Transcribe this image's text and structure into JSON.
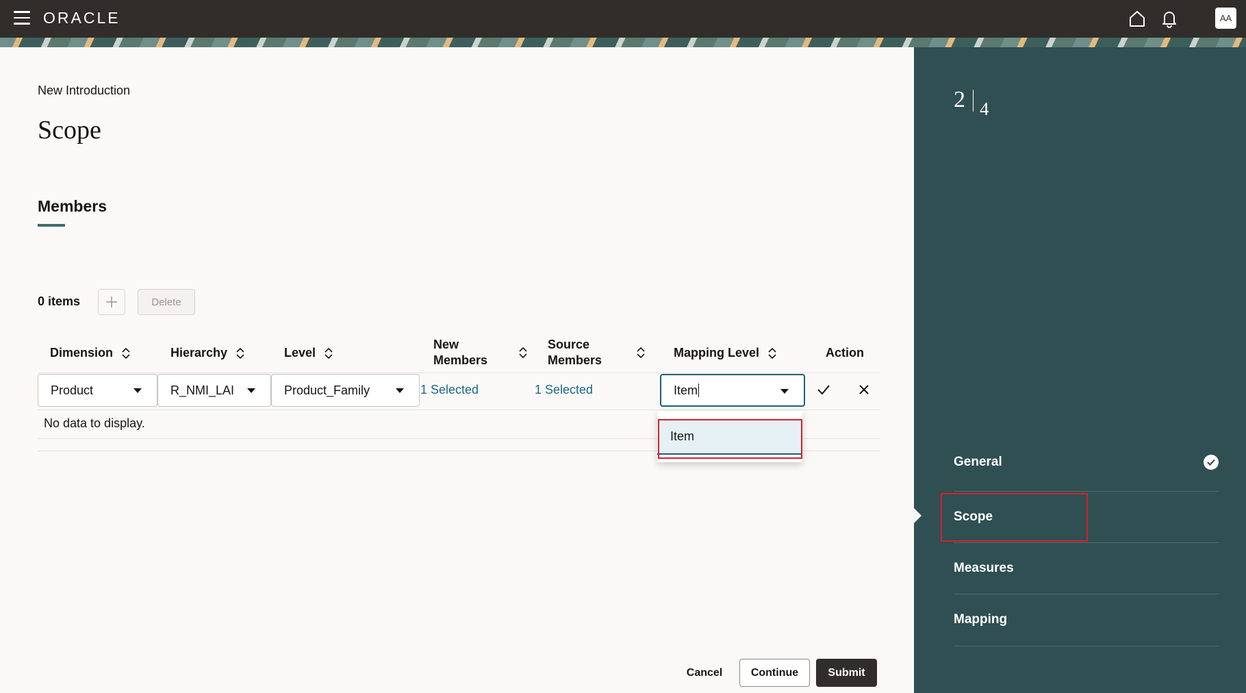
{
  "header": {
    "logo": "ORACLE",
    "avatar_initials": "AA"
  },
  "page": {
    "breadcrumb": "New Introduction",
    "title": "Scope",
    "section_title": "Members",
    "items_count": "0 items",
    "delete_label": "Delete",
    "no_data_text": "No data to display."
  },
  "table": {
    "columns": [
      {
        "label": "Dimension"
      },
      {
        "label": "Hierarchy"
      },
      {
        "label": "Level"
      },
      {
        "label": "New Members"
      },
      {
        "label": "Source Members"
      },
      {
        "label": "Mapping Level"
      },
      {
        "label": "Action"
      }
    ],
    "row": {
      "dimension": "Product",
      "hierarchy": "R_NMI_LAI",
      "level": "Product_Family",
      "new_members": "1 Selected",
      "source_members": "1 Selected",
      "mapping_level": "Item"
    }
  },
  "dropdown": {
    "options": [
      {
        "label": "Item"
      }
    ]
  },
  "footer": {
    "cancel_label": "Cancel",
    "continue_label": "Continue",
    "submit_label": "Submit"
  },
  "steps": {
    "current": "2",
    "total": "4",
    "items": [
      {
        "label": "General",
        "status": "complete"
      },
      {
        "label": "Scope",
        "status": "current"
      },
      {
        "label": "Measures",
        "status": "pending"
      },
      {
        "label": "Mapping",
        "status": "pending"
      }
    ]
  },
  "colors": {
    "topbar": "#312d2a",
    "panel": "#2f4f52",
    "link": "#1c6886",
    "highlight": "#d8202a"
  }
}
